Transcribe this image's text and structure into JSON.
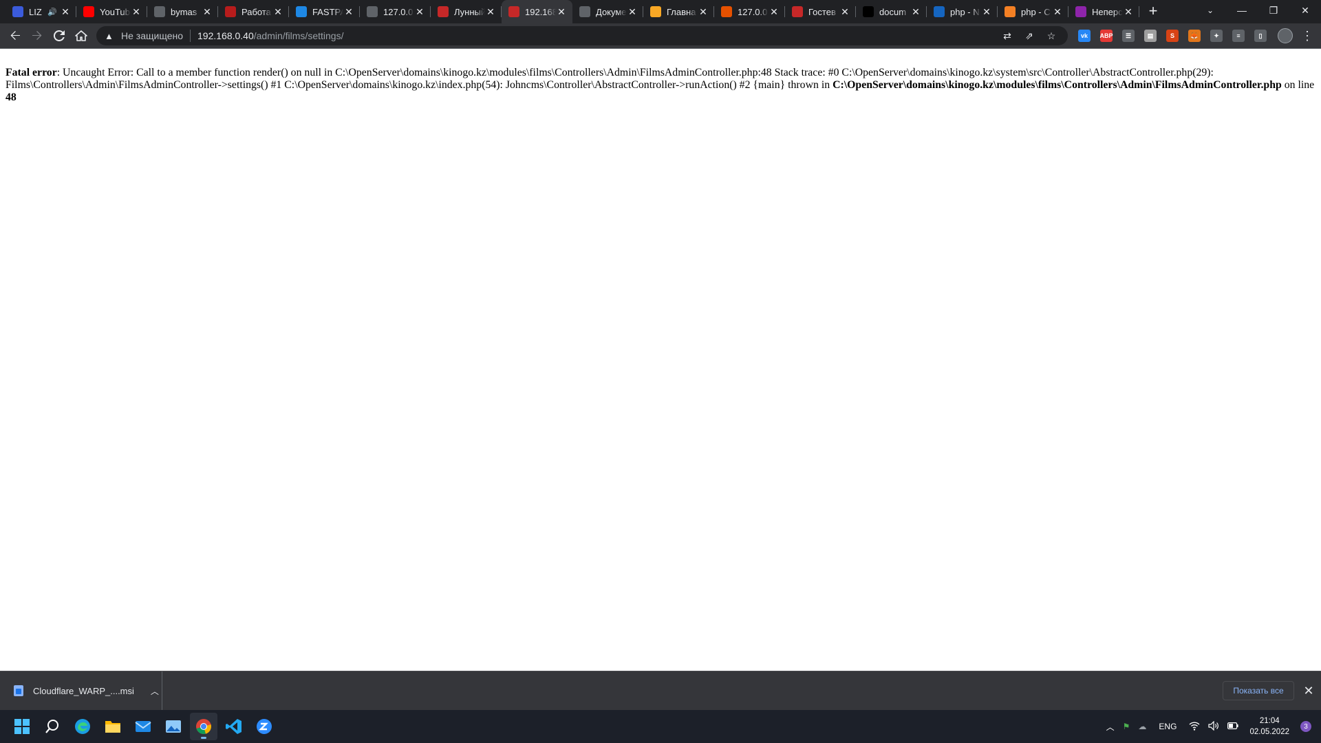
{
  "browser": {
    "tabs": [
      {
        "title": "LIZ",
        "favicon": "youtube-music-icon",
        "color": "#3b5bdb",
        "audio": true,
        "active": false
      },
      {
        "title": "YouTube",
        "favicon": "youtube-icon",
        "color": "#ff0000",
        "active": false
      },
      {
        "title": "bymas",
        "favicon": "fingerprint-icon",
        "color": "#5f6368",
        "active": false
      },
      {
        "title": "Работа",
        "favicon": "work-icon",
        "color": "#b71c1c",
        "active": false
      },
      {
        "title": "FASTPA",
        "favicon": "fastpanel-icon",
        "color": "#1e88e5",
        "active": false
      },
      {
        "title": "127.0.0",
        "favicon": "globe-icon",
        "color": "#5f6368",
        "active": false
      },
      {
        "title": "Лунный",
        "favicon": "site-icon",
        "color": "#c62828",
        "active": false
      },
      {
        "title": "192.168",
        "favicon": "site-icon",
        "color": "#c62828",
        "active": true
      },
      {
        "title": "Докуме",
        "favicon": "play-icon",
        "color": "#5f6368",
        "active": false
      },
      {
        "title": "Главна",
        "favicon": "coin-icon",
        "color": "#f9a825",
        "active": false
      },
      {
        "title": "127.0.0",
        "favicon": "warning-icon",
        "color": "#e65100",
        "active": false
      },
      {
        "title": "Гостев",
        "favicon": "site-icon",
        "color": "#c62828",
        "active": false
      },
      {
        "title": "docum",
        "favicon": "github-icon",
        "color": "#000000",
        "active": false
      },
      {
        "title": "php - N",
        "favicon": "document-icon",
        "color": "#1565c0",
        "active": false
      },
      {
        "title": "php - C",
        "favicon": "stackoverflow-icon",
        "color": "#f48024",
        "active": false
      },
      {
        "title": "Неперс",
        "favicon": "app-icon",
        "color": "#8e24aa",
        "active": false
      }
    ],
    "new_tab_label": "+",
    "window_controls": {
      "tab_search": "⌄",
      "minimize": "—",
      "restore": "❐",
      "close": "✕"
    },
    "security_icon": "warning-triangle-icon",
    "security_label": "Не защищено",
    "url_host": "192.168.0.40",
    "url_path": "/admin/films/settings/",
    "extensions": [
      {
        "name": "vk-extension-icon",
        "label": "vk",
        "color": "#2787f5"
      },
      {
        "name": "adblock-plus-icon",
        "label": "ABP",
        "color": "#e53935"
      },
      {
        "name": "list-extension-icon",
        "label": "☰",
        "color": "#5f6368"
      },
      {
        "name": "note-extension-icon",
        "label": "▤",
        "color": "#9e9e9e"
      },
      {
        "name": "s-extension-icon",
        "label": "S",
        "color": "#d84315"
      },
      {
        "name": "metamask-icon",
        "label": "🦊",
        "color": "#e2761b"
      },
      {
        "name": "puzzle-extensions-icon",
        "label": "✦",
        "color": "#5f6368"
      },
      {
        "name": "reading-list-icon",
        "label": "≡",
        "color": "#5f6368"
      },
      {
        "name": "side-panel-icon",
        "label": "▯",
        "color": "#5f6368"
      }
    ]
  },
  "page": {
    "error_label": "Fatal error",
    "error_message": ": Uncaught Error: Call to a member function render() on null in C:\\OpenServer\\domains\\kinogo.kz\\modules\\films\\Controllers\\Admin\\FilmsAdminController.php:48 Stack trace: #0 C:\\OpenServer\\domains\\kinogo.kz\\system\\src\\Controller\\AbstractController.php(29): Films\\Controllers\\Admin\\FilmsAdminController->settings() #1 C:\\OpenServer\\domains\\kinogo.kz\\index.php(54): Johncms\\Controller\\AbstractController->runAction() #2 {main} thrown in ",
    "error_file": "C:\\OpenServer\\domains\\kinogo.kz\\modules\\films\\Controllers\\Admin\\FilmsAdminController.php",
    "on_line_text": " on line ",
    "error_line": "48"
  },
  "download_shelf": {
    "file_name": "Cloudflare_WARP_....msi",
    "show_all_label": "Показать все"
  },
  "taskbar": {
    "language": "ENG",
    "time": "21:04",
    "date": "02.05.2022",
    "notification_count": "3"
  }
}
